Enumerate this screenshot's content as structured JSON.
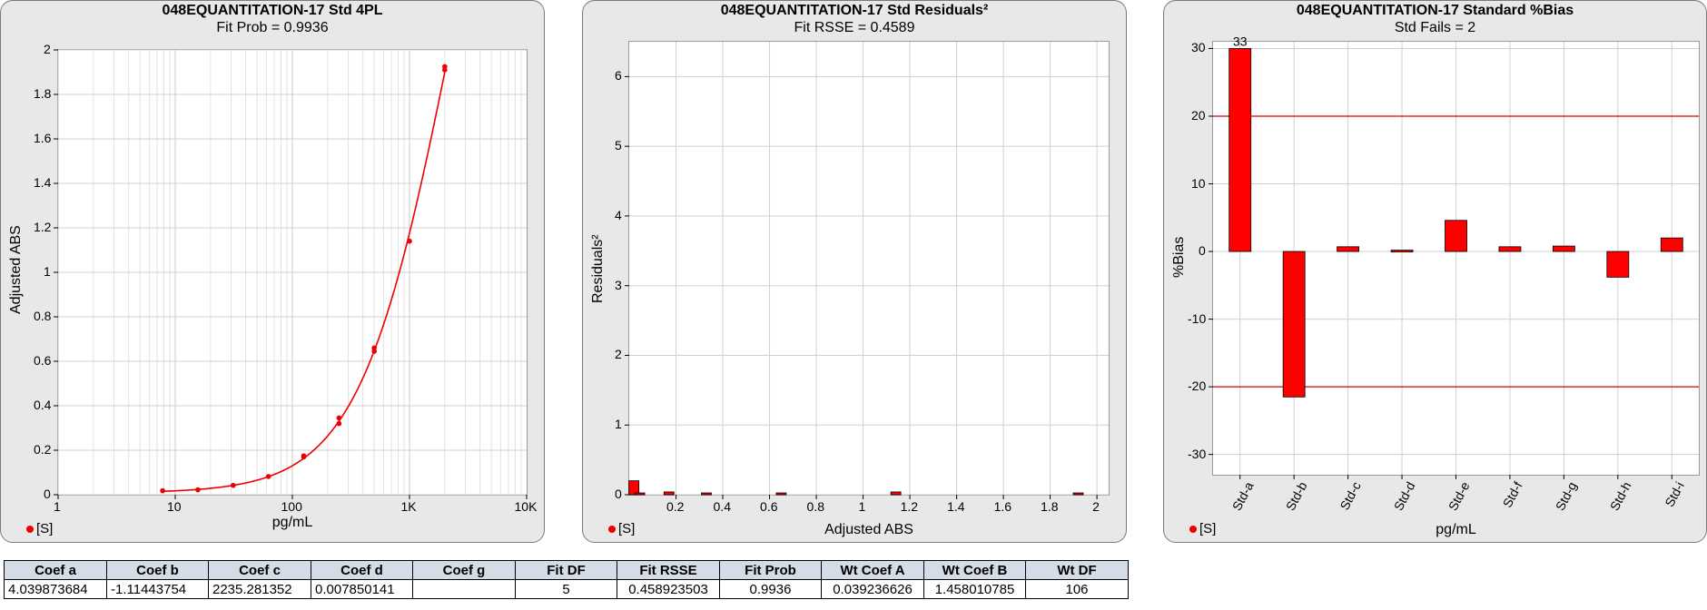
{
  "colors": {
    "marker": "#ee0000",
    "bar": "#ff0000",
    "grid": "#d0d0d0",
    "limit_line": "#dd0000"
  },
  "legend_label": "[S]",
  "chart_data": [
    {
      "type": "scatter",
      "title": "048EQUANTITATION-17  Std 4PL",
      "subtitle": "Fit Prob = 0.9936",
      "xlabel": "pg/mL",
      "ylabel": "Adjusted ABS",
      "xscale": "log",
      "xlim": [
        1,
        10000
      ],
      "ylim": [
        0,
        2
      ],
      "xticks": [
        "1",
        "10",
        "100",
        "1K",
        "10K"
      ],
      "yticks": [
        "0",
        "0.2",
        "0.4",
        "0.6",
        "0.8",
        "1",
        "1.2",
        "1.4",
        "1.6",
        "1.8",
        "2"
      ],
      "grid": true,
      "legend": "bottom-left",
      "points": [
        {
          "x": 7.8,
          "y": 0.018
        },
        {
          "x": 15.6,
          "y": 0.022
        },
        {
          "x": 31.25,
          "y": 0.042
        },
        {
          "x": 62.5,
          "y": 0.082
        },
        {
          "x": 125,
          "y": 0.17
        },
        {
          "x": 125,
          "y": 0.175
        },
        {
          "x": 250,
          "y": 0.32
        },
        {
          "x": 250,
          "y": 0.345
        },
        {
          "x": 500,
          "y": 0.645
        },
        {
          "x": 500,
          "y": 0.66
        },
        {
          "x": 1000,
          "y": 1.14
        },
        {
          "x": 2000,
          "y": 1.91
        },
        {
          "x": 2000,
          "y": 1.925
        }
      ],
      "fit": {
        "model": "4PL",
        "a": 4.039873684,
        "b": -1.11443754,
        "c": 2235.281352,
        "d": 0.007850141
      }
    },
    {
      "type": "bar",
      "title": "048EQUANTITATION-17  Std  Residuals²",
      "subtitle": "Fit RSSE = 0.4589",
      "xlabel": "Adjusted ABS",
      "ylabel": "Residuals²",
      "xlim": [
        0,
        2.05
      ],
      "ylim": [
        0,
        6.5
      ],
      "xticks": [
        "0.2",
        "0.4",
        "0.6",
        "0.8",
        "1",
        "1.2",
        "1.4",
        "1.6",
        "1.8",
        "2"
      ],
      "yticks": [
        "0",
        "1",
        "2",
        "3",
        "4",
        "5",
        "6"
      ],
      "grid": true,
      "legend": "bottom-left",
      "bars": [
        {
          "x": 0.02,
          "y": 0.2
        },
        {
          "x": 0.045,
          "y": 0.01
        },
        {
          "x": 0.17,
          "y": 0.04
        },
        {
          "x": 0.33,
          "y": 0.01
        },
        {
          "x": 0.65,
          "y": 0.01
        },
        {
          "x": 1.14,
          "y": 0.04
        },
        {
          "x": 1.92,
          "y": 0.01
        }
      ]
    },
    {
      "type": "bar",
      "title": "048EQUANTITATION-17 Standard %Bias",
      "subtitle": "Std Fails = 2",
      "xlabel": "pg/mL",
      "ylabel": "%Bias",
      "categories": [
        "Std-a",
        "Std-b",
        "Std-c",
        "Std-d",
        "Std-e",
        "Std-f",
        "Std-g",
        "Std-h",
        "Std-i"
      ],
      "values": [
        33,
        -21.5,
        0.7,
        0.2,
        4.6,
        0.7,
        0.8,
        -3.8,
        2.0
      ],
      "annotation": "33",
      "ylim": [
        -33,
        31
      ],
      "yticks": [
        "30",
        "20",
        "10",
        "0",
        "-10",
        "-20",
        "-30"
      ],
      "limit_lines": [
        20,
        -20
      ],
      "grid": true,
      "legend": "bottom-left"
    }
  ],
  "table": {
    "headers": [
      "Coef a",
      "Coef b",
      "Coef c",
      "Coef d",
      "Coef g",
      "Fit DF",
      "Fit RSSE",
      "Fit Prob",
      "Wt Coef A",
      "Wt Coef B",
      "Wt DF"
    ],
    "rows": [
      [
        "4.039873684",
        "-1.11443754",
        "2235.281352",
        "0.007850141",
        "",
        "5",
        "0.458923503",
        "0.9936",
        "0.039236626",
        "1.458010785",
        "106"
      ]
    ]
  }
}
